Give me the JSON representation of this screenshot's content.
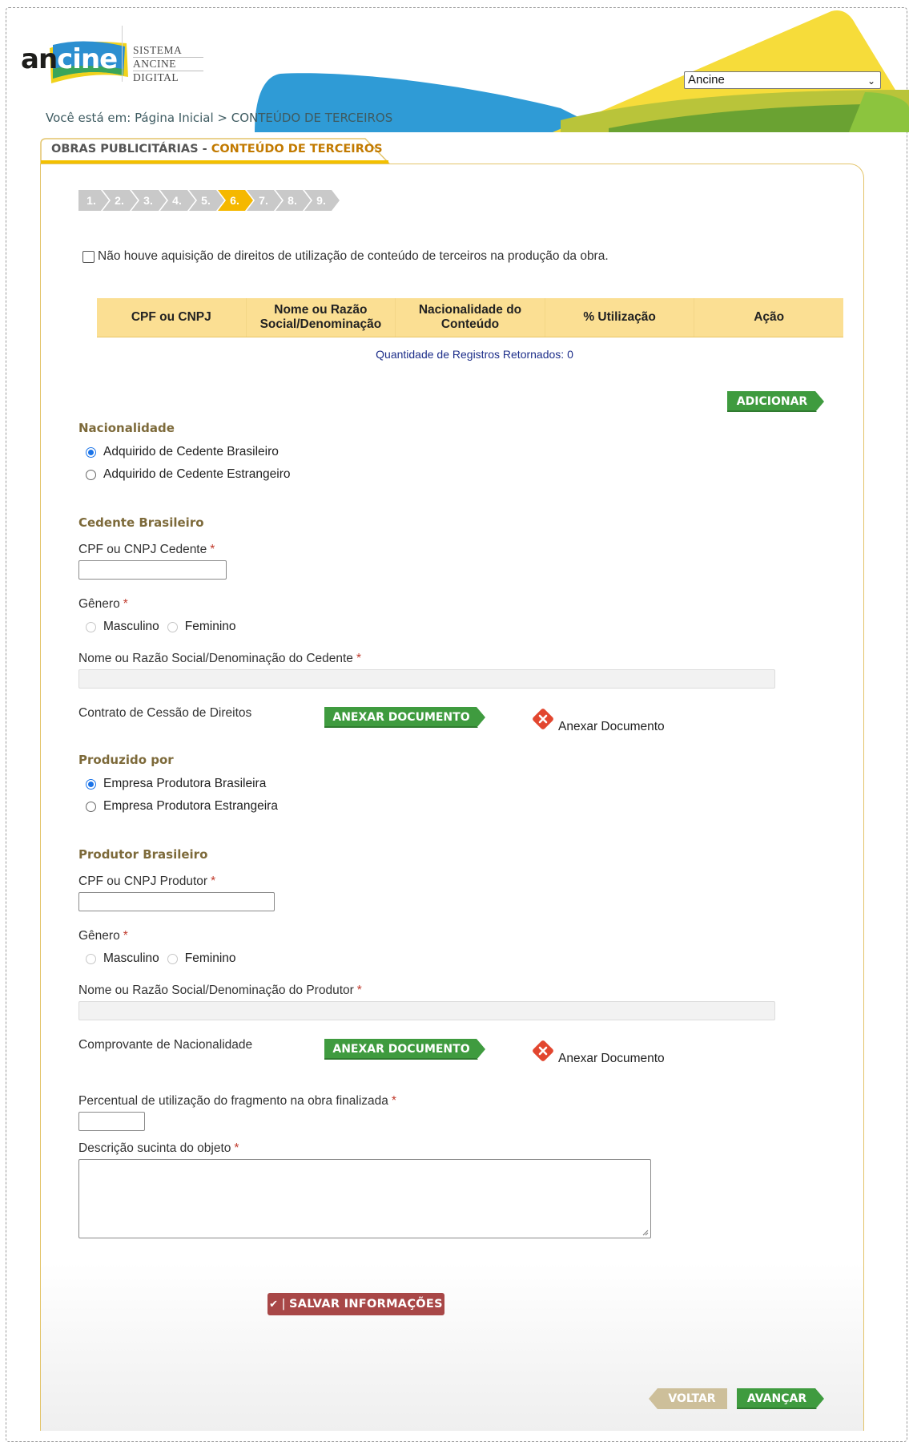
{
  "header": {
    "logo_prefix": "an",
    "logo_suffix": "cine",
    "system_lines": [
      "SISTEMA",
      "ANCINE",
      "DIGITAL"
    ],
    "org_select_value": "Ancine",
    "breadcrumb": "Você está em: Página Inicial > CONTEÚDO DE TERCEIROS"
  },
  "section": {
    "title_prefix": "OBRAS PUBLICITÁRIAS - ",
    "title_highlight": "CONTEÚDO DE TERCEIROS"
  },
  "steps": {
    "items": [
      "1.",
      "2.",
      "3.",
      "4.",
      "5.",
      "6.",
      "7.",
      "8.",
      "9."
    ],
    "active": "6."
  },
  "no_rights_checkbox": {
    "label": "Não houve aquisição de direitos de utilização de conteúdo de terceiros na produção da obra.",
    "checked": false
  },
  "table": {
    "headers": [
      "CPF ou CNPJ",
      "Nome ou Razão Social/Denominação",
      "Nacionalidade do Conteúdo",
      "% Utilização",
      "Ação"
    ],
    "rows": [],
    "records_text": "Quantidade de Registros Retornados: 0"
  },
  "add_button_label": "ADICIONAR",
  "nationality": {
    "title": "Nacionalidade",
    "options": [
      "Adquirido de Cedente Brasileiro",
      "Adquirido de Cedente Estrangeiro"
    ],
    "selected": "Adquirido de Cedente Brasileiro"
  },
  "cedente": {
    "title": "Cedente Brasileiro",
    "cpf_label": "CPF ou CNPJ Cedente",
    "cpf_value": "",
    "genero_label": "Gênero",
    "genero_options": [
      "Masculino",
      "Feminino"
    ],
    "nome_label": "Nome ou Razão Social/Denominação do Cedente",
    "nome_value": "",
    "contrato_label": "Contrato de Cessão de Direitos",
    "attach_button": "ANEXAR DOCUMENTO",
    "attach_status": "Anexar Documento"
  },
  "produzido_por": {
    "title": "Produzido por",
    "options": [
      "Empresa Produtora Brasileira",
      "Empresa Produtora Estrangeira"
    ],
    "selected": "Empresa Produtora Brasileira"
  },
  "produtor": {
    "title": "Produtor Brasileiro",
    "cpf_label": "CPF ou CNPJ Produtor",
    "cpf_value": "",
    "genero_label": "Gênero",
    "genero_options": [
      "Masculino",
      "Feminino"
    ],
    "nome_label": "Nome ou Razão Social/Denominação do Produtor",
    "nome_value": "",
    "comprovante_label": "Comprovante de Nacionalidade",
    "attach_button": "ANEXAR DOCUMENTO",
    "attach_status": "Anexar Documento"
  },
  "percentual": {
    "label": "Percentual de utilização do fragmento na obra finalizada",
    "value": ""
  },
  "descricao": {
    "label": "Descrição sucinta do objeto",
    "value": ""
  },
  "required_marker": "*",
  "actions": {
    "save": "SALVAR INFORMAÇÕES",
    "back": "VOLTAR",
    "next": "AVANÇAR"
  },
  "colors": {
    "step_inactive": "#c9c9c9",
    "step_active": "#f5b800",
    "button_green": "#3f9b3f",
    "button_back": "#cdbf9a",
    "save_red": "#a84747",
    "table_header": "#fbdf93",
    "error_icon": "#e2462f"
  }
}
